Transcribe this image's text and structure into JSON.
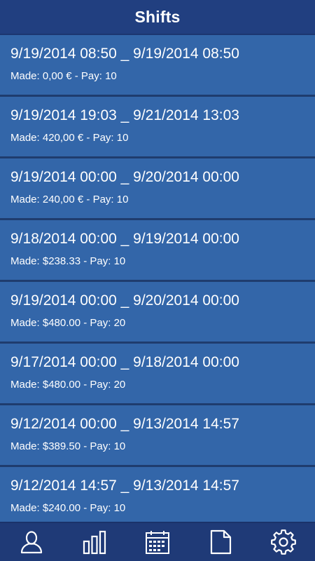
{
  "header": {
    "title": "Shifts"
  },
  "shifts": [
    {
      "range": "9/19/2014 08:50 _ 9/19/2014 08:50",
      "meta": "Made: 0,00 € - Pay: 10"
    },
    {
      "range": "9/19/2014 19:03 _ 9/21/2014 13:03",
      "meta": "Made: 420,00 € - Pay: 10"
    },
    {
      "range": "9/19/2014 00:00 _ 9/20/2014 00:00",
      "meta": "Made: 240,00 € - Pay: 10"
    },
    {
      "range": "9/18/2014 00:00 _ 9/19/2014 00:00",
      "meta": "Made: $238.33 - Pay: 10"
    },
    {
      "range": "9/19/2014 00:00 _ 9/20/2014 00:00",
      "meta": "Made: $480.00 - Pay: 20"
    },
    {
      "range": "9/17/2014 00:00 _ 9/18/2014 00:00",
      "meta": "Made: $480.00 - Pay: 20"
    },
    {
      "range": "9/12/2014 00:00 _ 9/13/2014 14:57",
      "meta": "Made: $389.50 - Pay: 10"
    },
    {
      "range": "9/12/2014 14:57 _ 9/13/2014 14:57",
      "meta": "Made: $240.00 - Pay: 10"
    }
  ],
  "bottom_nav": {
    "items": [
      {
        "icon": "user-icon"
      },
      {
        "icon": "bar-chart-icon"
      },
      {
        "icon": "calendar-icon"
      },
      {
        "icon": "document-icon"
      },
      {
        "icon": "gear-icon"
      }
    ]
  },
  "colors": {
    "header_bg": "#213f80",
    "item_bg": "#3366a9",
    "divider": "#1f3c6e",
    "nav_bg": "#1f3a77",
    "text": "#ffffff"
  }
}
